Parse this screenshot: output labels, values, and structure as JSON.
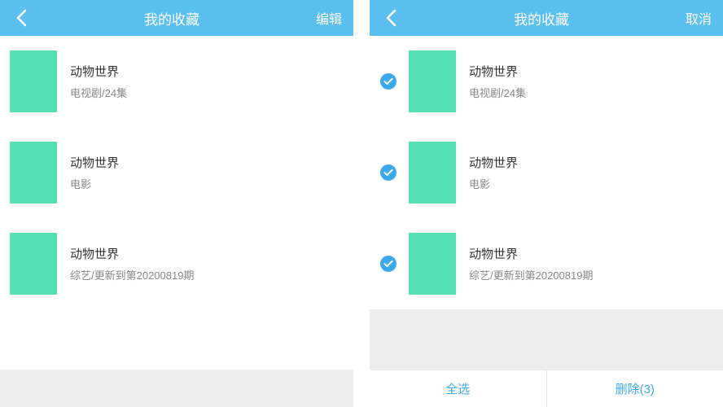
{
  "colors": {
    "header_bg": "#5bc0f0",
    "thumb_bg": "#55dfb5",
    "link": "#3ba8ea"
  },
  "screenA": {
    "header": {
      "title": "我的收藏",
      "action": "编辑"
    },
    "items": [
      {
        "title": "动物世界",
        "subtitle": "电视剧/24集"
      },
      {
        "title": "动物世界",
        "subtitle": "电影"
      },
      {
        "title": "动物世界",
        "subtitle": "综艺/更新到第20200819期"
      }
    ]
  },
  "screenB": {
    "header": {
      "title": "我的收藏",
      "action": "取消"
    },
    "items": [
      {
        "title": "动物世界",
        "subtitle": "电视剧/24集",
        "checked": true
      },
      {
        "title": "动物世界",
        "subtitle": "电影",
        "checked": true
      },
      {
        "title": "动物世界",
        "subtitle": "综艺/更新到第20200819期",
        "checked": true
      }
    ],
    "footer": {
      "select_all": "全选",
      "delete": "删除(3)"
    }
  }
}
